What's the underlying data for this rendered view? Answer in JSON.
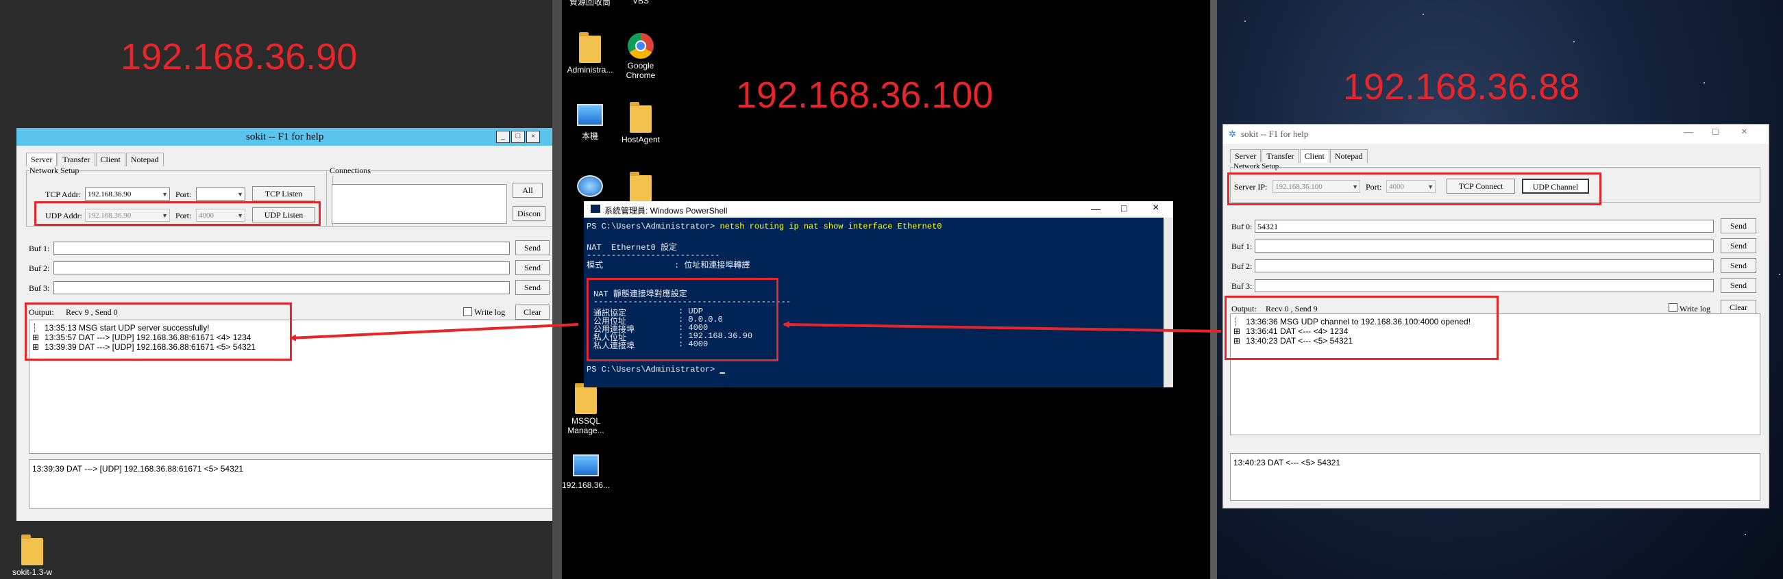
{
  "left": {
    "ip_label": "192.168.36.90",
    "window_title": "sokit -- F1 for help",
    "tabs": [
      "Server",
      "Transfer",
      "Client",
      "Notepad"
    ],
    "network_setup": "Network Setup",
    "connections": "Connections",
    "tcp_addr_label": "TCP Addr:",
    "tcp_addr_value": "192.168.36.90",
    "tcp_port_label": "Port:",
    "tcp_port_value": "",
    "tcp_listen": "TCP Listen",
    "udp_addr_label": "UDP Addr:",
    "udp_addr_value": "192.168.36.90",
    "udp_port_label": "Port:",
    "udp_port_value": "4000",
    "udp_listen": "UDP Listen",
    "all_button": "All",
    "disconn_button": "Discon",
    "buf_labels": [
      "Buf 1:",
      "Buf 2:",
      "Buf 3:"
    ],
    "send": "Send",
    "output_label": "Output:",
    "stats": "Recv 9 , Send 0",
    "write_log": "Write log",
    "clear": "Clear",
    "log": [
      "13:35:13 MSG start UDP server successfully!",
      "13:35:57 DAT ---> [UDP] 192.168.36.88:61671 <4> 1234",
      "13:39:39 DAT ---> [UDP] 192.168.36.88:61671 <5> 54321"
    ],
    "detail": "13:39:39 DAT ---> [UDP] 192.168.36.88:61671 <5> 54321",
    "desktop_icon": "sokit-1.3-w"
  },
  "middle": {
    "ip_label": "192.168.36.100",
    "icons": [
      {
        "label": "資源回收筒",
        "icon": "recycle-bin-icon"
      },
      {
        "label": "VBS",
        "icon": "vbs-icon"
      },
      {
        "label": "Administra...",
        "icon": "user-folder-icon"
      },
      {
        "label": "Google Chrome",
        "icon": "chrome-icon"
      },
      {
        "label": "本機",
        "icon": "this-pc-icon"
      },
      {
        "label": "HostAgent",
        "icon": "folder-icon"
      },
      {
        "label": "MSSQL Manage...",
        "icon": "folder-icon"
      },
      {
        "label": "192.168.36...",
        "icon": "remote-pc-icon"
      }
    ],
    "ps_title": "系統管理員: Windows PowerShell",
    "ps_prompt": "PS C:\\Users\\Administrator>",
    "ps_command": "netsh routing ip nat show interface Ethernet0",
    "nat_heading": "NAT  Ethernet0 設定",
    "mode_label": "模式",
    "mode_value": ": 位址和連接埠轉譯",
    "static_heading": "NAT 靜態連接埠對應設定",
    "mappings": [
      {
        "label": "通訊協定",
        "value": ": UDP"
      },
      {
        "label": "公用位址",
        "value": ": 0.0.0.0"
      },
      {
        "label": "公用連接埠",
        "value": ": 4000"
      },
      {
        "label": "私人位址",
        "value": ": 192.168.36.90"
      },
      {
        "label": "私人連接埠",
        "value": ": 4000"
      }
    ]
  },
  "right": {
    "ip_label": "192.168.36.88",
    "window_title": "sokit -- F1 for help",
    "tabs": [
      "Server",
      "Transfer",
      "Client",
      "Notepad"
    ],
    "network_setup": "Network Setup",
    "server_ip_label": "Server IP:",
    "server_ip_value": "192.168.36.100",
    "port_label": "Port:",
    "port_value": "4000",
    "tcp_connect": "TCP Connect",
    "udp_channel": "UDP Channel",
    "buf_labels": [
      "Buf 0:",
      "Buf 1:",
      "Buf 2:",
      "Buf 3:"
    ],
    "buf0_value": "54321",
    "send": "Send",
    "output_label": "Output:",
    "stats": "Recv 0 , Send 9",
    "write_log": "Write log",
    "clear": "Clear",
    "log": [
      "13:36:36 MSG UDP channel to 192.168.36.100:4000 opened!",
      "13:36:41 DAT <--- <4> 1234",
      "13:40:23 DAT <--- <5> 54321"
    ],
    "detail": "13:40:23 DAT <--- <5> 54321"
  },
  "colors": {
    "annotation": "#e8262a",
    "powershell_bg": "#012456",
    "sokit_title_left": "#5bc4ec"
  }
}
